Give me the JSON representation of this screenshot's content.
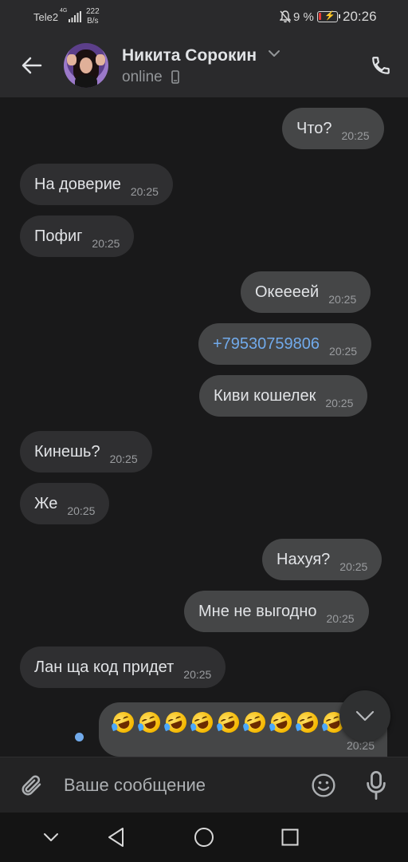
{
  "status_bar": {
    "carrier": "Tele2",
    "network": "4G",
    "speed_value": "222",
    "speed_unit": "B/s",
    "battery_percent": "9 %",
    "time": "20:26"
  },
  "header": {
    "contact_name": "Никита Сорокин",
    "status": "online"
  },
  "messages": [
    {
      "direction": "out",
      "text": "Что?",
      "time": "20:25"
    },
    {
      "direction": "in",
      "text": "На доверие",
      "time": "20:25"
    },
    {
      "direction": "in",
      "text": "Пофиг",
      "time": "20:25"
    },
    {
      "direction": "out",
      "text": "Океееей",
      "time": "20:25"
    },
    {
      "direction": "out",
      "text": "+79530759806",
      "time": "20:25",
      "is_link": true
    },
    {
      "direction": "out",
      "text": "Киви кошелек",
      "time": "20:25"
    },
    {
      "direction": "in",
      "text": "Кинешь?",
      "time": "20:25"
    },
    {
      "direction": "in",
      "text": "Же",
      "time": "20:25"
    },
    {
      "direction": "out",
      "text": "Нахуя?",
      "time": "20:25"
    },
    {
      "direction": "out",
      "text": "Мне не выгодно",
      "time": "20:25"
    },
    {
      "direction": "in",
      "text": "Лан ща код придет",
      "time": "20:25"
    },
    {
      "direction": "out",
      "emoji": "rolling-on-floor-laughing",
      "emoji_count": 9,
      "time": "20:25",
      "unread": true
    }
  ],
  "composer": {
    "placeholder": "Ваше сообщение"
  },
  "colors": {
    "background": "#19191a",
    "header": "#2a2a2c",
    "bubble_in": "#2f2f31",
    "bubble_out": "#454647",
    "link": "#71aaeb",
    "battery_low": "#e53935"
  },
  "icons": [
    "back-arrow-icon",
    "chevron-down-icon",
    "mobile-phone-icon",
    "phone-call-icon",
    "attach-paperclip-icon",
    "emoji-smile-icon",
    "microphone-icon",
    "chevron-down-icon",
    "nav-back-icon",
    "nav-home-icon",
    "nav-recents-icon",
    "nav-hide-icon"
  ]
}
